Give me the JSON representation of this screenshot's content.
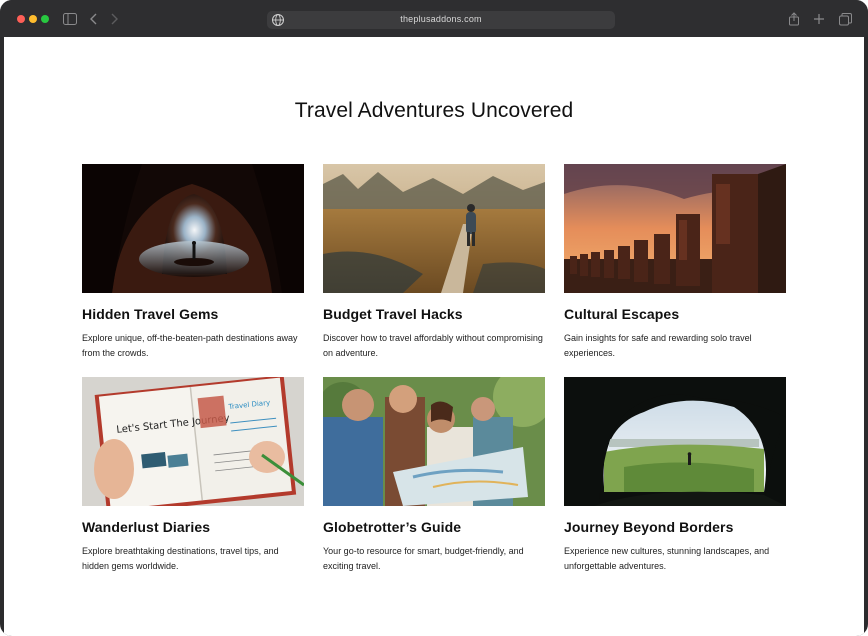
{
  "browser": {
    "url": "theplusaddons.com"
  },
  "page": {
    "title": "Travel Adventures Uncovered"
  },
  "cards": [
    {
      "title": "Hidden Travel Gems",
      "description": "Explore unique, off-the-beaten-path destinations away from the crowds.",
      "image": "cave-silhouette-photo"
    },
    {
      "title": "Budget Travel Hacks",
      "description": "Discover how to travel affordably without compromising on adventure.",
      "image": "hiker-boardwalk-photo"
    },
    {
      "title": "Cultural Escapes",
      "description": "Gain insights for safe and rewarding solo travel experiences.",
      "image": "moai-statues-photo"
    },
    {
      "title": "Wanderlust Diaries",
      "description": "Explore breathtaking destinations, travel tips, and hidden gems worldwide.",
      "image": "travel-journal-photo"
    },
    {
      "title": "Globetrotter’s Guide",
      "description": "Your go-to resource for smart, budget-friendly, and exciting travel.",
      "image": "friends-map-photo"
    },
    {
      "title": "Journey Beyond Borders",
      "description": "Experience new cultures, stunning landscapes, and unforgettable adventures.",
      "image": "cave-landscape-photo"
    }
  ],
  "journal_text": {
    "left_page": "Let's Start The Journey",
    "right_page": "Travel Diary"
  }
}
